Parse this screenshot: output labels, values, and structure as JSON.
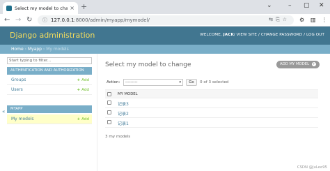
{
  "browser": {
    "tab_title": "Select my model to change | ...",
    "tab_close": "×",
    "new_tab": "+",
    "url_host": "127.0.0.1",
    "url_path": ":8000/admin/myapp/mymodel/",
    "info_icon": "ⓘ",
    "window_controls": {
      "minimize": "–",
      "maximize": "▢",
      "close": "✕"
    }
  },
  "header": {
    "brand": "Django administration",
    "welcome": "WELCOME,",
    "username": "JACK",
    "view_site": "VIEW SITE",
    "change_password": "CHANGE PASSWORD",
    "logout": "LOG OUT",
    "separator": "/"
  },
  "breadcrumbs": {
    "home": "Home",
    "app": "Myapp",
    "current": "My models",
    "separator": "›"
  },
  "sidebar": {
    "filter_placeholder": "Start typing to filter...",
    "modules": [
      {
        "caption": "AUTHENTICATION AND AUTHORIZATION",
        "rows": [
          {
            "label": "Groups",
            "add": "Add"
          },
          {
            "label": "Users",
            "add": "Add"
          }
        ]
      },
      {
        "caption": "MYAPP",
        "rows": [
          {
            "label": "My models",
            "add": "Add"
          }
        ]
      }
    ],
    "collapse_icon": "«"
  },
  "main": {
    "title": "Select my model to change",
    "add_button": "ADD MY MODEL",
    "action_label": "Action:",
    "action_selected": "---------",
    "go_button": "Go",
    "selected_count": "0 of 3 selected",
    "column_header": "MY MODEL",
    "rows": [
      "记录3",
      "记录2",
      "记录1"
    ],
    "paginator": "3 my models"
  },
  "watermark": "CSDN @JuLee95",
  "colors": {
    "header_bg": "#417690",
    "brand_yellow": "#f5dd5d",
    "breadcrumb_bg": "#79aec8",
    "module_caption_bg": "#79aec8",
    "link_blue": "#447e9b",
    "add_green": "#70bf2b",
    "active_row_bg": "#ffffc8"
  }
}
